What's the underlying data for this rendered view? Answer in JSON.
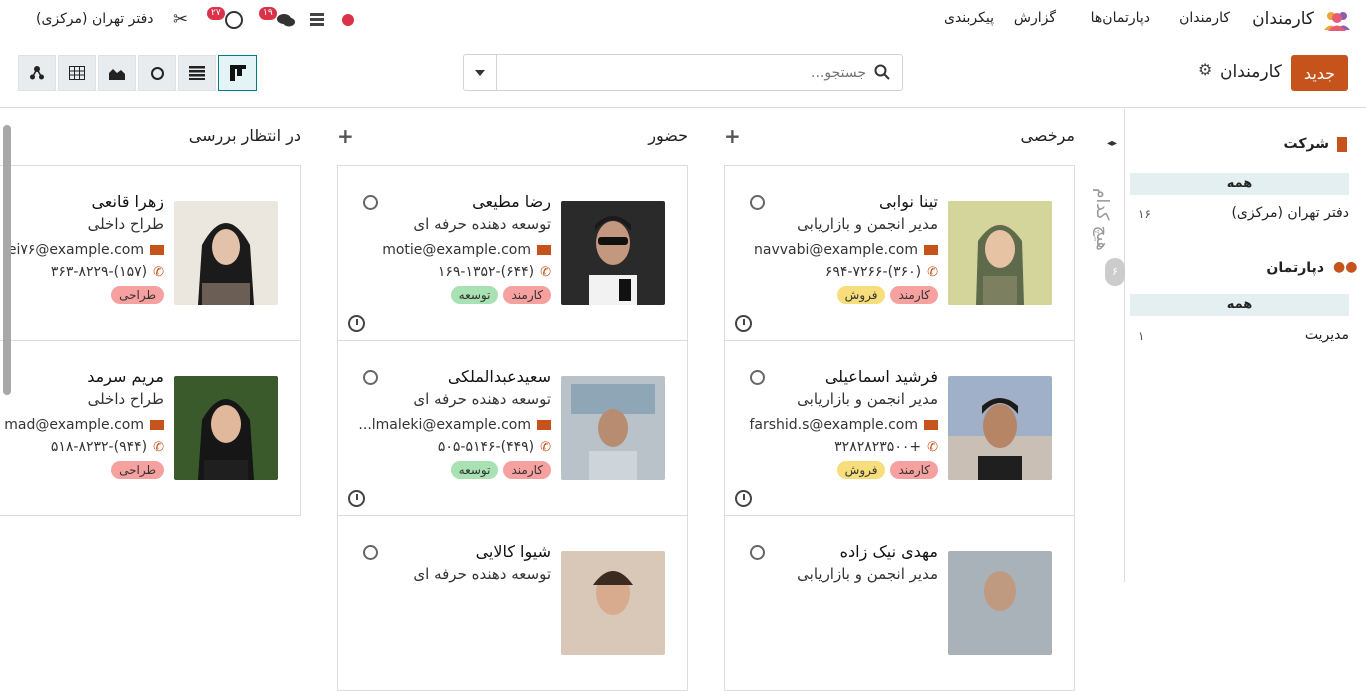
{
  "nav": {
    "app_name": "کارمندان",
    "menu": [
      "کارمندان",
      "دپارتمان‌ها",
      "گزارش",
      "پیکربندی"
    ],
    "company": "دفتر تهران (مرکزی)",
    "chat_badge": "۱۹",
    "activity_badge": "۲۷"
  },
  "control": {
    "new_label": "جدید",
    "breadcrumb": "کارمندان",
    "search_placeholder": "جستجو..."
  },
  "side": {
    "company_title": "شرکت",
    "company_all": "همه",
    "company_items": [
      {
        "label": "دفتر تهران (مرکزی)",
        "count": "۱۶"
      }
    ],
    "dept_title": "دپارتمان",
    "dept_all": "همه",
    "dept_items": [
      {
        "label": "مدیریت",
        "count": "۱"
      }
    ]
  },
  "folded": {
    "label": "هیچ کدام",
    "count": "۶"
  },
  "columns": [
    {
      "title": "مرخصی"
    },
    {
      "title": "حضور"
    },
    {
      "title": "در انتظار بررسی"
    }
  ],
  "cards": {
    "c1": {
      "name": "تینا نوابی",
      "job": "مدیر انجمن و بازاریابی",
      "email": "navvabi@example.com",
      "phone": "(۳۶۰)-۶۹۴-۷۲۶۶",
      "tag1": "کارمند",
      "tag2": "فروش"
    },
    "c2": {
      "name": "فرشید اسماعیلی",
      "job": "مدیر انجمن و بازاریابی",
      "email": "farshid.s@example.com",
      "phone": "+۳۲۸۲۸۲۳۵۰۰",
      "tag1": "کارمند",
      "tag2": "فروش"
    },
    "c3": {
      "name": "مهدی نیک زاده",
      "job": "مدیر انجمن و بازاریابی"
    },
    "c4": {
      "name": "رضا مطیعی",
      "job": "توسعه دهنده حرفه ای",
      "email": "motie@example.com",
      "phone": "(۶۴۴)-۱۶۹-۱۳۵۲",
      "tag1": "کارمند",
      "tag2": "توسعه"
    },
    "c5": {
      "name": "سعیدعبدالملکی",
      "job": "توسعه دهنده حرفه ای",
      "email": "lmaleki@example.com...",
      "phone": "(۴۴۹)-۵۰۵-۵۱۴۶",
      "tag1": "کارمند",
      "tag2": "توسعه"
    },
    "c6": {
      "name": "شیوا کالایی",
      "job": "توسعه دهنده حرفه ای"
    },
    "c7": {
      "name": "زهرا قانعی",
      "job": "طراح داخلی",
      "email": "ei۷۶@example.com",
      "phone": "(۱۵۷)-۳۶۳-۸۲۲۹",
      "tag1": "طراحی"
    },
    "c8": {
      "name": "مریم سرمد",
      "job": "طراح داخلی",
      "email": "mad@example.com",
      "phone": "(۹۴۴)-۵۱۸-۸۲۳۲",
      "tag1": "طراحی"
    }
  },
  "colors": {
    "accent": "#c5531b",
    "teal": "#017e84",
    "badge": "#d9334a"
  }
}
